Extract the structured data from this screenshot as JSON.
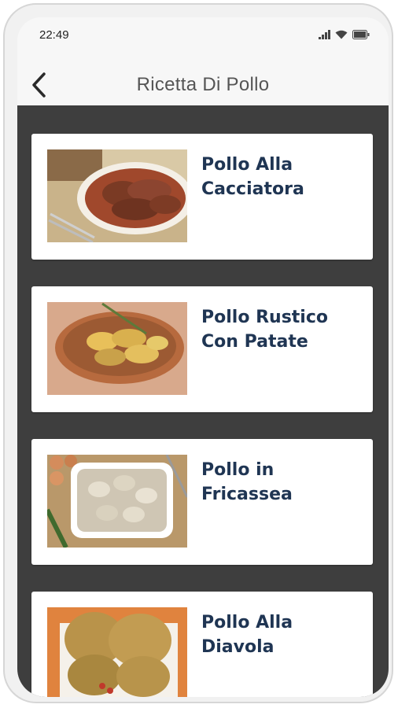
{
  "status_bar": {
    "time": "22:49",
    "icons": [
      "signal-icon",
      "wifi-icon",
      "battery-icon"
    ]
  },
  "app_bar": {
    "back_icon": "chevron-left-icon",
    "title": "Ricetta Di Pollo"
  },
  "recipes": [
    {
      "title": "Pollo Alla Cacciatora",
      "image": "chicken-cacciatora-photo"
    },
    {
      "title": "Pollo Rustico Con Patate",
      "image": "rustic-chicken-potatoes-photo"
    },
    {
      "title": "Pollo in Fricassea",
      "image": "chicken-fricassee-photo"
    },
    {
      "title": "Pollo Alla Diavola",
      "image": "devil-chicken-photo"
    }
  ],
  "colors": {
    "list_background": "#3e3e3e",
    "card_background": "#ffffff",
    "title_text": "#1f3553",
    "app_title_text": "#555555"
  }
}
